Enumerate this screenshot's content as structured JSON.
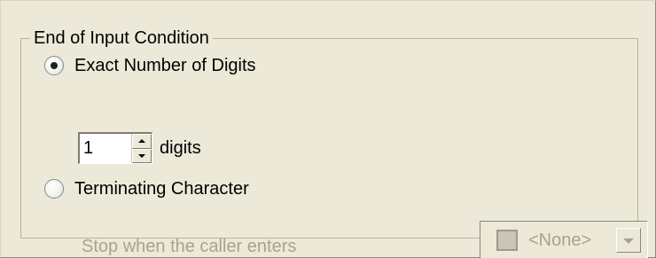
{
  "group": {
    "title": "End of Input Condition"
  },
  "options": {
    "exact_digits_label": "Exact Number of Digits",
    "terminating_character_label": "Terminating Character"
  },
  "digits": {
    "value": "1",
    "unit_label": "digits"
  },
  "disabled": {
    "stop_text": "Stop when the caller enters",
    "combo_value": "<None>"
  },
  "icons": {
    "radio_checked": "radio-checked-icon",
    "radio_unchecked": "radio-unchecked-icon",
    "spin_up": "chevron-up-icon",
    "spin_down": "chevron-down-icon",
    "combo_drop": "chevron-down-icon"
  },
  "colors": {
    "window_bg": "#ece9d8",
    "disabled_text": "#a7a292",
    "border": "#b8b2a0"
  }
}
